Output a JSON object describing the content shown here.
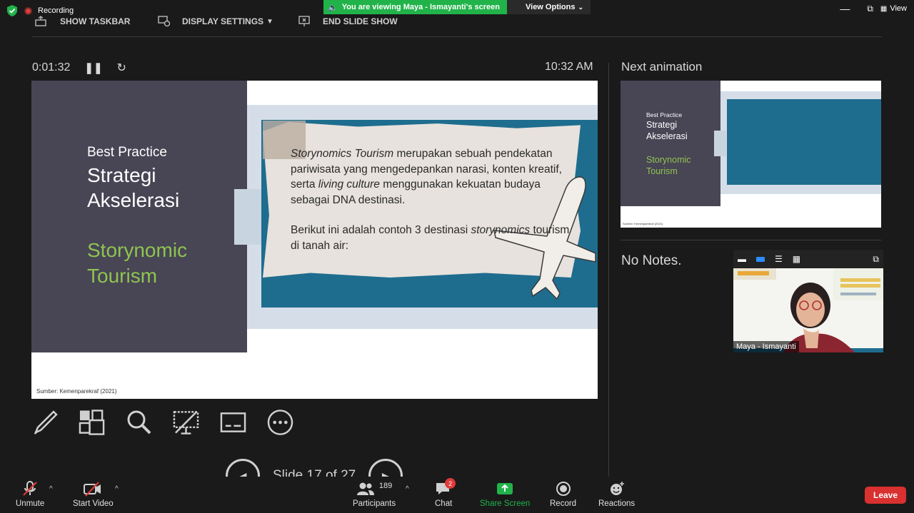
{
  "top": {
    "recording_label": "Recording",
    "banner_text": "You are viewing Maya - Ismayanti's screen",
    "view_options_label": "View Options",
    "view_label": "View",
    "show_taskbar_label": "SHOW TASKBAR",
    "display_settings_label": "DISPLAY SETTINGS",
    "end_slide_show_label": "END SLIDE SHOW"
  },
  "presenter": {
    "elapsed": "0:01:32",
    "clock": "10:32 AM",
    "next_animation_label": "Next animation",
    "notes_text": "No Notes.",
    "slide_counter": "Slide 17 of 27"
  },
  "slide": {
    "kicker": "Best Practice",
    "title_line1": "Strategi",
    "title_line2": "Akselerasi",
    "green_line1": "Storynomic",
    "green_line2": "Tourism",
    "para1_em1": "Storynomics Tourism",
    "para1_text1": " merupakan sebuah pendekatan pariwisata yang mengedepankan narasi, konten kreatif, serta ",
    "para1_em2": "living culture",
    "para1_text2": " menggunakan kekuatan budaya sebagai DNA destinasi.",
    "para2_text1": "Berikut ini adalah contoh 3 destinasi ",
    "para2_em": "storynomics",
    "para2_text2": " tourism di tanah air:",
    "source": "Sumber: Kemenparekraf (2021)"
  },
  "thumb": {
    "kicker": "Best Practice",
    "title_line1": "Strategi",
    "title_line2": "Akselerasi",
    "green_line1": "Storynomic",
    "green_line2": "Tourism",
    "source": "Sumber: Kemenparekraf (2021)"
  },
  "video": {
    "participant_name": "Maya - Ismayanti"
  },
  "toolbar": {
    "unmute_label": "Unmute",
    "start_video_label": "Start Video",
    "participants_label": "Participants",
    "participants_count": "189",
    "chat_label": "Chat",
    "chat_badge": "2",
    "share_screen_label": "Share Screen",
    "record_label": "Record",
    "reactions_label": "Reactions",
    "leave_label": "Leave"
  },
  "colors": {
    "accent_green": "#21b34a",
    "slide_green": "#8fc44f",
    "leave_red": "#d93030",
    "slide_teal": "#1e6d8f",
    "slide_dark": "#484555"
  }
}
